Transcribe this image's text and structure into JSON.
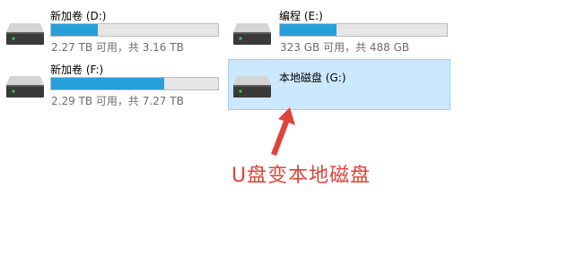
{
  "drives": [
    {
      "name": "新加卷 (D:)",
      "capacity": "2.27 TB 可用，共 3.16 TB",
      "used_fraction": 0.28,
      "selected": false
    },
    {
      "name": "编程 (E:)",
      "capacity": "323 GB 可用，共 488 GB",
      "used_fraction": 0.34,
      "selected": false
    },
    {
      "name": "新加卷 (F:)",
      "capacity": "2.29 TB 可用，共 7.27 TB",
      "used_fraction": 0.68,
      "selected": false
    },
    {
      "name": "本地磁盘 (G:)",
      "capacity": "",
      "used_fraction": null,
      "selected": true
    }
  ],
  "annotation": {
    "text": "U盘变本地磁盘",
    "color": "#e0433a"
  },
  "colors": {
    "usage_fill": "#26a0da",
    "selection_bg": "#cce8ff",
    "selection_border": "#99d1ff"
  },
  "icons": {
    "drive": "hard-drive-icon",
    "pointer": "red-arrow-icon"
  }
}
